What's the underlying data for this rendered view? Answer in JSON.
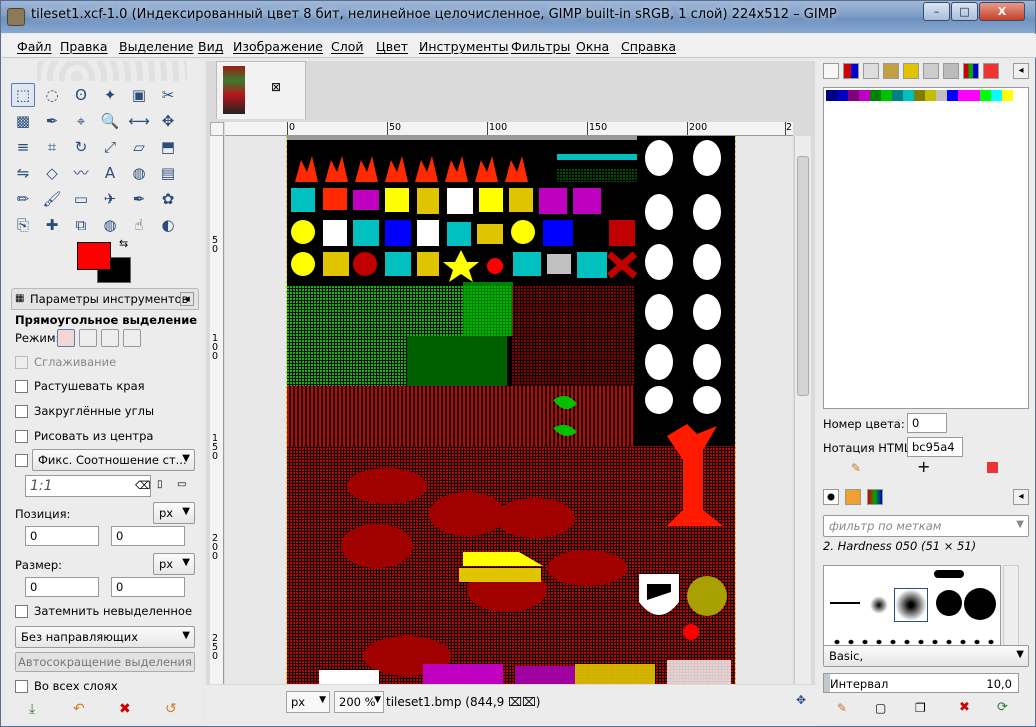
{
  "window": {
    "title": "tileset1.xcf-1.0 (Индексированный цвет 8 бит, нелинейное целочисленное, GIMP built-in sRGB, 1 слой) 224x512 – GIMP",
    "buttons": {
      "minimize": "–",
      "maximize": "□",
      "close": "X"
    }
  },
  "menu": [
    "Файл",
    "Правка",
    "Выделение",
    "Вид",
    "Изображение",
    "Слой",
    "Цвет",
    "Инструменты",
    "Фильтры",
    "Окна",
    "Справка"
  ],
  "colors": {
    "foreground": "#ff0000",
    "background": "#000000",
    "selection_outline": "#e0c400"
  },
  "tools": [
    "rect-select",
    "ellipse-select",
    "free-select",
    "fuzzy-select",
    "by-color-select",
    "scissors-select",
    "foreground-select",
    "paths",
    "color-picker",
    "zoom",
    "measure",
    "move",
    "align",
    "crop",
    "rotate",
    "scale",
    "shear",
    "perspective",
    "flip",
    "cage",
    "warp",
    "text",
    "bucket-fill",
    "blend",
    "pencil",
    "paintbrush",
    "eraser",
    "airbrush",
    "ink",
    "mypaint",
    "clone",
    "heal",
    "perspective-clone",
    "blur",
    "smudge",
    "dodge-burn"
  ],
  "tool_options": {
    "tab_label": "Параметры инструментов",
    "title": "Прямоугольное выделение",
    "mode_label": "Режим:",
    "antialias": "Сглаживание",
    "feather": "Растушевать края",
    "rounded": "Закруглённые углы",
    "from_center": "Рисовать из центра",
    "fixed": "Фикс. Соотношение ст...",
    "ratio": "1:1",
    "position_label": "Позиция:",
    "position_unit": "px",
    "position_x": "0",
    "position_y": "0",
    "size_label": "Размер:",
    "size_unit": "px",
    "size_w": "0",
    "size_h": "0",
    "highlight": "Затемнить невыделенное",
    "guides": "Без направляющих",
    "autoshrink": "Автосокращение выделения",
    "merged": "Во всех слоях"
  },
  "ruler": {
    "h": [
      "0",
      "50",
      "100",
      "150",
      "200",
      "2"
    ],
    "v": [
      "5\n0",
      "1\n0\n0",
      "1\n5\n0",
      "2\n0\n0",
      "2\n5\n0"
    ]
  },
  "status": {
    "unit": "px",
    "zoom": "200 %",
    "file": "tileset1.bmp (844,9 ⌧⌧)"
  },
  "palette_panel": {
    "swatches": [
      "#000080",
      "#0000c0",
      "#800080",
      "#c000c0",
      "#008000",
      "#00c000",
      "#008080",
      "#00c0c0",
      "#808000",
      "#c0c000",
      "#c0c0c0",
      "#0000ff",
      "#ff00ff",
      "#ff00ff",
      "#00ff00",
      "#00ffff",
      "#ffff00"
    ],
    "index_label": "Номер цвета:",
    "index_value": "0",
    "html_label": "Нотация HTML:",
    "html_value": "bc95a4"
  },
  "brushes_panel": {
    "filter_placeholder": "фильтр по меткам",
    "current": "2. Hardness 050 (51 × 51)",
    "preset": "Basic,",
    "spacing_label": "Интервал",
    "spacing_value": "10,0"
  }
}
